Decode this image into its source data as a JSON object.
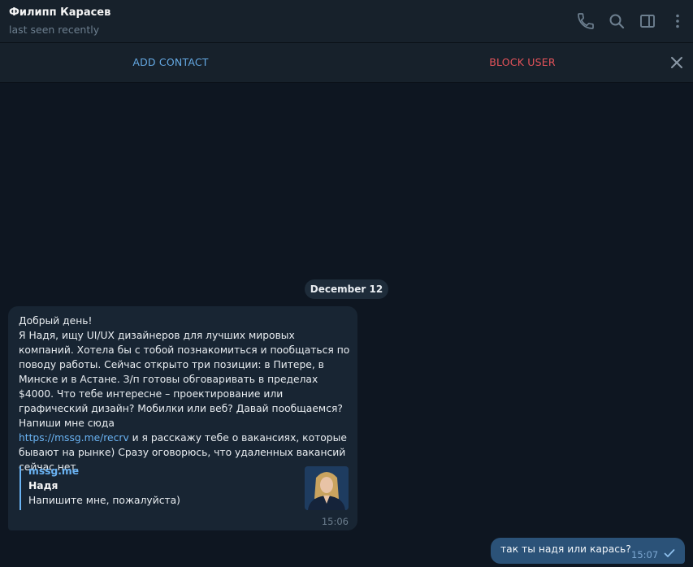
{
  "header": {
    "chat_name": "Филипп Карасев",
    "status": "last seen recently",
    "icons": [
      "phone-icon",
      "search-icon",
      "sidebar-toggle-icon",
      "more-vertical-icon"
    ]
  },
  "action_bar": {
    "add_contact": "ADD CONTACT",
    "block_user": "BLOCK USER",
    "close_icon": "close-icon"
  },
  "date_separator": "December 12",
  "incoming_message": {
    "text_before_link": "Добрый день!\nЯ Надя, ищу UI/UX дизайнеров для лучших мировых компаний. Хотела бы с тобой познакомиться и пообщаться по поводу работы. Сейчас открыто три позиции: в Питере, в Минске и в Астане. З/п готовы обговаривать в пределах $4000. Что тебе интересне – проектирование или графический дизайн? Мобилки или веб? Давай пообщаемся? Напиши мне сюда\n",
    "link": "https://mssg.me/recrv",
    "text_after_link": " и я расскажу тебе о вакансиях, которые бывают на рынке) Сразу оговорюсь, что удаленных вакансий сейчас нет.",
    "preview": {
      "site": "mssg.me",
      "title": "Надя",
      "description": "Напишите мне, пожалуйста)"
    },
    "time": "15:06"
  },
  "outgoing_message": {
    "text": "так ты надя или карась?",
    "time": "15:07",
    "status_icon": "check-icon"
  },
  "colors": {
    "background": "#0e1621",
    "header": "#17212b",
    "incoming_bubble": "#182533",
    "outgoing_bubble": "#2b5278",
    "link": "#6ab3f3",
    "add_contact": "#64a8e2",
    "block_user": "#e5535a"
  }
}
